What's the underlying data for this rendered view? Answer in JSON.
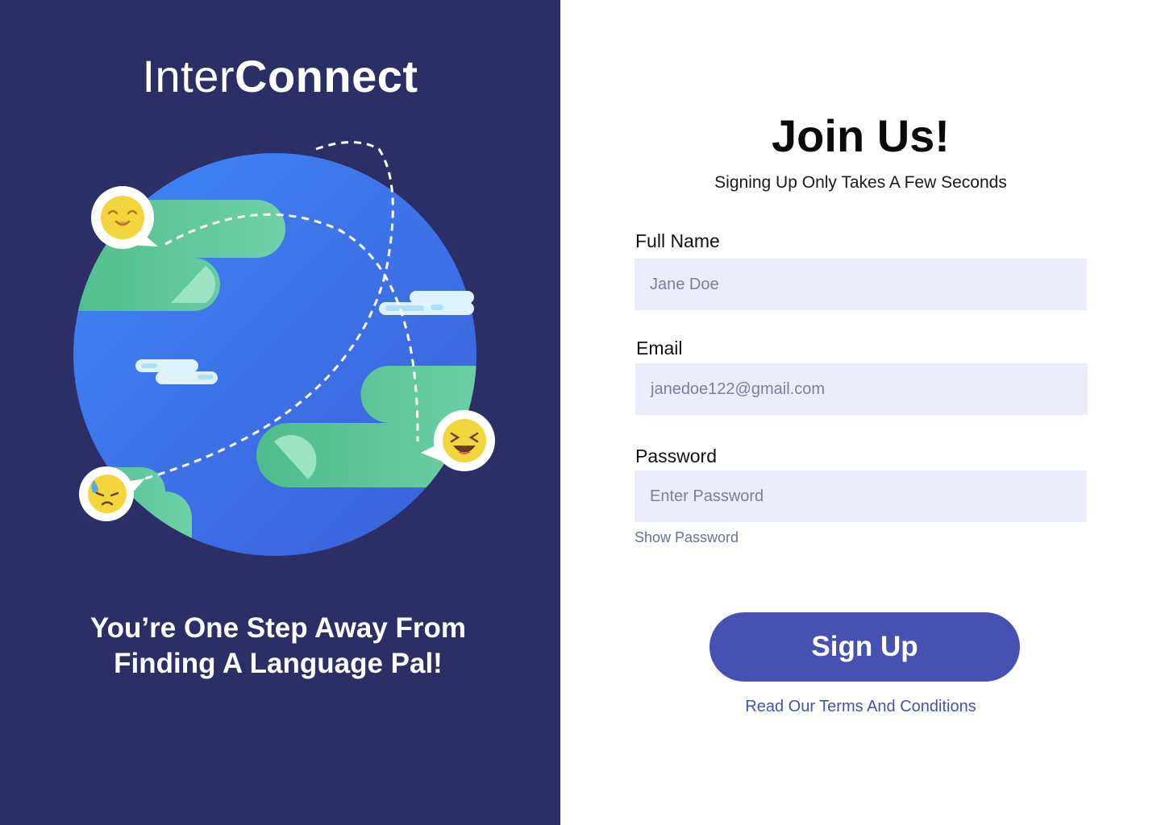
{
  "brand": {
    "logo_light": "Inter",
    "logo_bold": "Connect"
  },
  "left": {
    "tagline": "You’re One Step Away From Finding A Language Pal!"
  },
  "form": {
    "title": "Join Us!",
    "subtitle": "Signing Up Only Takes A Few Seconds",
    "fields": [
      {
        "label": "Full Name",
        "placeholder": "Jane Doe"
      },
      {
        "label": "Email",
        "placeholder": "janedoe122@gmail.com"
      },
      {
        "label": "Password",
        "placeholder": "Enter Password"
      }
    ],
    "show_password": "Show Password",
    "submit_label": "Sign Up",
    "terms_link": "Read Our Terms And Conditions"
  },
  "colors": {
    "left_background": "#2c2f66",
    "globe_ocean": "#3b7bf2",
    "land": "#5cc499",
    "input_background": "#ebedfc",
    "button": "#4651b1",
    "link": "#4651b1"
  },
  "icons": [
    "globe-illustration",
    "smiling-emoji-icon",
    "laughing-emoji-icon",
    "sad-emoji-icon",
    "cloud-icon"
  ]
}
